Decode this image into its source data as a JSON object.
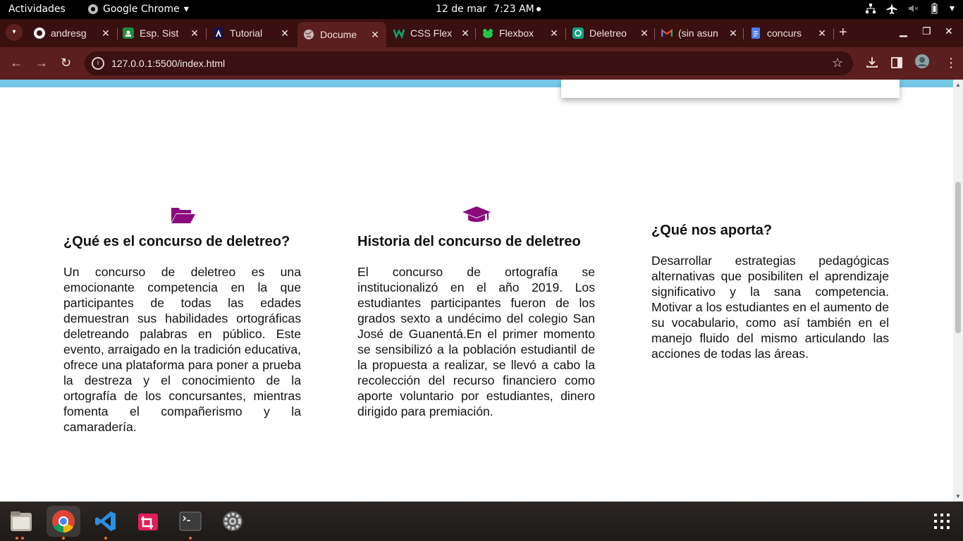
{
  "topbar": {
    "activities": "Actividades",
    "app_name": "Google Chrome",
    "date": "12 de mar",
    "time": "7:23 AM"
  },
  "tabs": [
    {
      "title": "andresg",
      "icon": "github-icon"
    },
    {
      "title": "Esp. Sist",
      "icon": "classroom-icon"
    },
    {
      "title": "Tutorial",
      "icon": "angular-icon"
    },
    {
      "title": "Docume",
      "icon": "globe-icon",
      "active": true
    },
    {
      "title": "CSS Flex",
      "icon": "w3-icon"
    },
    {
      "title": "Flexbox",
      "icon": "froggy-icon"
    },
    {
      "title": "Deletreo",
      "icon": "chatgpt-icon"
    },
    {
      "title": "(sin asun",
      "icon": "gmail-icon"
    },
    {
      "title": "concurs",
      "icon": "docs-icon"
    }
  ],
  "toolbar": {
    "url": "127.0.0.1:5500/index.html"
  },
  "page": {
    "col1": {
      "title": "¿Qué es el concurso de deletreo?",
      "text": "Un concurso de deletreo es una emocionante competencia en la que participantes de todas las edades demuestran sus habilidades ortográficas deletreando palabras en público. Este evento, arraigado en la tradición educativa, ofrece una plataforma para poner a prueba la destreza y el conocimiento de la ortografía de los concursantes, mientras fomenta el compañerismo y la camaradería."
    },
    "col2": {
      "title": "Historia del concurso de deletreo",
      "text": "El concurso de ortografía se institucionalizó en el año 2019. Los estudiantes participantes fueron de los grados sexto a undécimo del colegio San José de Guanentá.En el primer momento se sensibilizó a la población estudiantil de la propuesta a realizar, se llevó a cabo la recolección del recurso financiero como aporte voluntario por estudiantes, dinero dirigido para premiación."
    },
    "col3": {
      "title": "¿Qué nos aporta?",
      "text": "Desarrollar estrategias pedagógicas alternativas que posibiliten el aprendizaje significativo y la sana competencia. Motivar a los estudiantes en el aumento de su vocabulario, como así también en el manejo fluido del mismo articulando las acciones de todas las áreas."
    },
    "accent_color": "#8b0a7d"
  },
  "dock": [
    "files-icon",
    "chrome-icon",
    "vscode-icon",
    "screenshot-icon",
    "terminal-icon",
    "settings-icon",
    "app-grid-icon"
  ]
}
